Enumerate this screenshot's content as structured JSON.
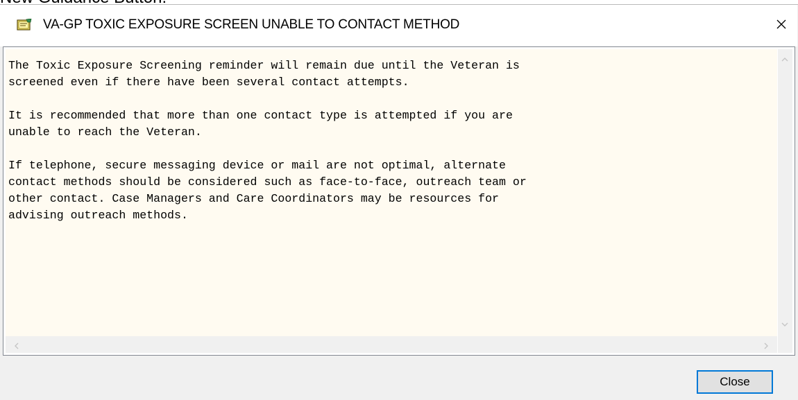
{
  "background": {
    "heading": "New Guidance Button:"
  },
  "window": {
    "title": "VA-GP TOXIC EXPOSURE SCREEN UNABLE TO CONTACT METHOD",
    "close_glyph": "✕"
  },
  "content": {
    "lines": [
      "The Toxic Exposure Screening reminder will remain due until the Veteran is",
      "screened even if there have been several contact attempts.",
      "",
      "It is recommended that more than one contact type is attempted if you are",
      "unable to reach the Veteran.",
      "",
      "If telephone, secure messaging device or mail are not optimal, alternate",
      "contact methods should be considered such as face-to-face, outreach team or",
      "other contact. Case Managers and Care Coordinators may be resources for",
      "advising outreach methods."
    ]
  },
  "scrollbars": {
    "up_arrow": "^",
    "down_arrow": "v",
    "left_arrow": "<",
    "right_arrow": ">"
  },
  "footer": {
    "close_label": "Close"
  },
  "icons": {
    "app": "notepad-icon",
    "close": "close-icon"
  },
  "colors": {
    "text_background": "#fffbf1",
    "window_background": "#f0f0f0",
    "button_focus_border": "#0078d7"
  }
}
